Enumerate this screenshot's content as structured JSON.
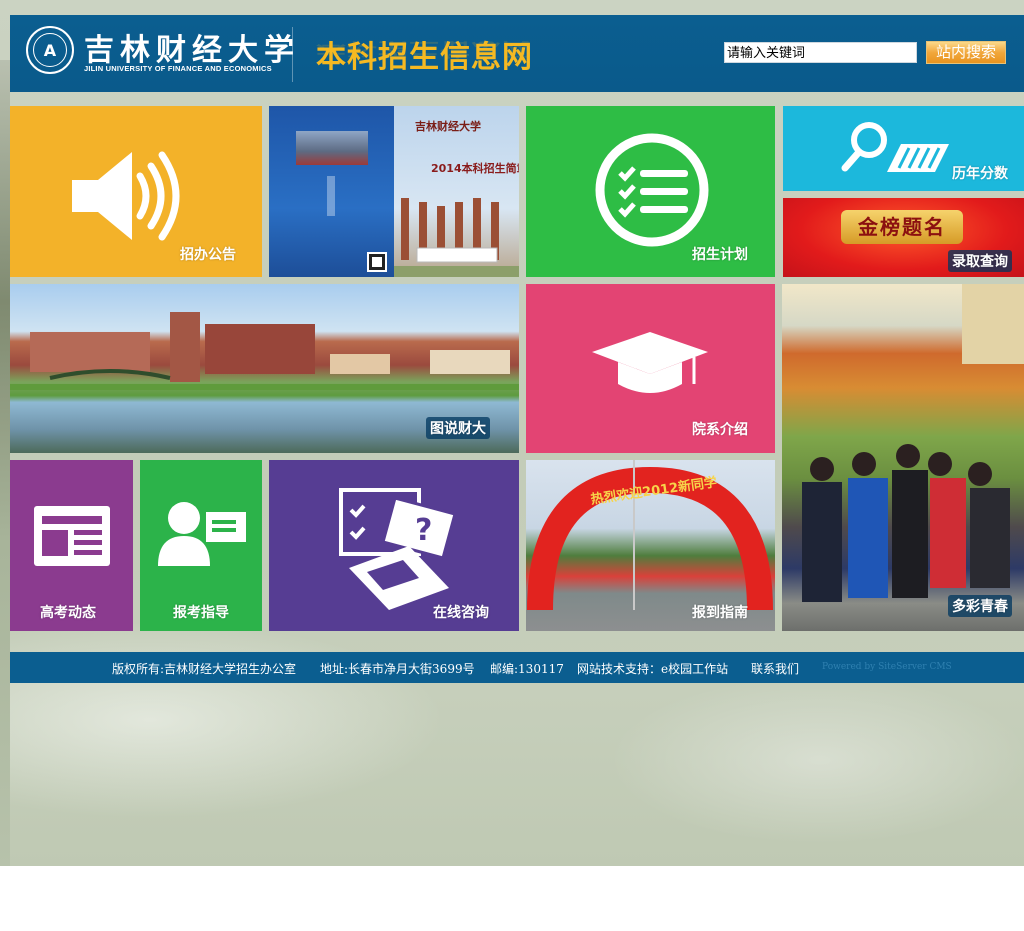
{
  "header": {
    "logo_cn": "吉林财经大学",
    "logo_en": "JILIN UNIVERSITY OF FINANCE AND ECONOMICS",
    "site_title": "本科招生信息网",
    "search_placeholder": "请输入关键词",
    "search_button": "站内搜索"
  },
  "tiles": {
    "announcements": "招办公告",
    "brochure_title": "2014本科招生简章",
    "brochure_cn": "吉林财经大学",
    "plan": "招生计划",
    "scores": "历年分数",
    "admission": "录取查询",
    "admission_banner": "金榜题名",
    "campus_pictures": "图说财大",
    "departments": "院系介绍",
    "youth": "多彩青春",
    "news": "高考动态",
    "guidance": "报考指导",
    "consult": "在线咨询",
    "arrival": "报到指南",
    "arch_text": "热烈欢迎2012新同学"
  },
  "footer": {
    "copyright": "版权所有:吉林财经大学招生办公室",
    "address": "地址:长春市净月大街3699号",
    "postcode": "邮编:130117",
    "tech_support": "网站技术支持：e校园工作站",
    "contact": "联系我们",
    "powered": "Powered by SiteServer CMS"
  },
  "colors": {
    "header_blue": "#0b5e90",
    "tile_orange": "#f3b229",
    "tile_green": "#2ebd45",
    "tile_cyan": "#1cb8dc",
    "tile_red": "#e8202c",
    "tile_pink": "#e34473",
    "tile_purple": "#8b3b8f",
    "tile_violet": "#563d93",
    "title_gold": "#f5b922"
  }
}
